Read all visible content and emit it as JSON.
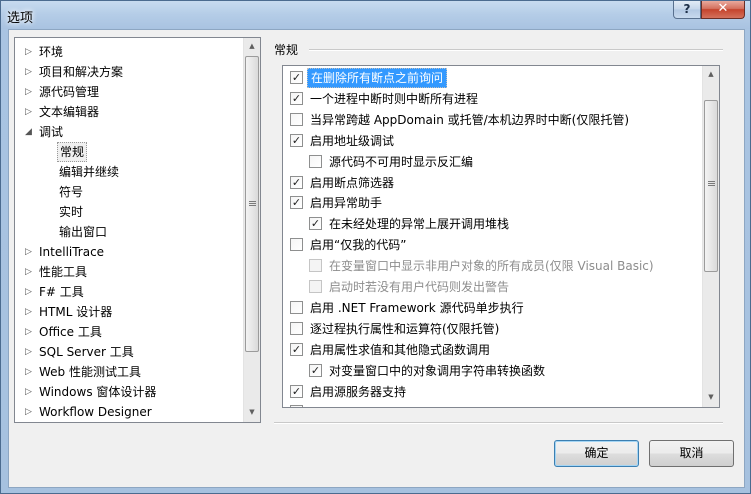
{
  "window": {
    "title": "选项",
    "help_label": "?",
    "close_label": "✕"
  },
  "tree": {
    "items": [
      {
        "label": "环境",
        "expanded": false
      },
      {
        "label": "项目和解决方案",
        "expanded": false
      },
      {
        "label": "源代码管理",
        "expanded": false
      },
      {
        "label": "文本编辑器",
        "expanded": false
      },
      {
        "label": "调试",
        "expanded": true
      },
      {
        "label": "常规",
        "child": true,
        "selected": true
      },
      {
        "label": "编辑并继续",
        "child": true
      },
      {
        "label": "符号",
        "child": true
      },
      {
        "label": "实时",
        "child": true
      },
      {
        "label": "输出窗口",
        "child": true
      },
      {
        "label": "IntelliTrace",
        "expanded": false
      },
      {
        "label": "性能工具",
        "expanded": false
      },
      {
        "label": "F# 工具",
        "expanded": false
      },
      {
        "label": "HTML 设计器",
        "expanded": false
      },
      {
        "label": "Office 工具",
        "expanded": false
      },
      {
        "label": "SQL Server 工具",
        "expanded": false
      },
      {
        "label": "Web 性能测试工具",
        "expanded": false
      },
      {
        "label": "Windows 窗体设计器",
        "expanded": false
      },
      {
        "label": "Workflow Designer",
        "expanded": false
      }
    ]
  },
  "section": {
    "title": "常规"
  },
  "options": [
    {
      "label": "在删除所有断点之前询问",
      "checked": true,
      "indent": 0,
      "highlight": true
    },
    {
      "label": "一个进程中断时则中断所有进程",
      "checked": true,
      "indent": 0
    },
    {
      "label": "当异常跨越 AppDomain 或托管/本机边界时中断(仅限托管)",
      "checked": false,
      "indent": 0
    },
    {
      "label": "启用地址级调试",
      "checked": true,
      "indent": 0
    },
    {
      "label": "源代码不可用时显示反汇编",
      "checked": false,
      "indent": 1
    },
    {
      "label": "启用断点筛选器",
      "checked": true,
      "indent": 0
    },
    {
      "label": "启用异常助手",
      "checked": true,
      "indent": 0
    },
    {
      "label": "在未经处理的异常上展开调用堆栈",
      "checked": true,
      "indent": 1
    },
    {
      "label": "启用“仅我的代码”",
      "checked": false,
      "indent": 0
    },
    {
      "label": "在变量窗口中显示非用户对象的所有成员(仅限 Visual Basic)",
      "checked": false,
      "indent": 1,
      "disabled": true
    },
    {
      "label": "启动时若没有用户代码则发出警告",
      "checked": false,
      "indent": 1,
      "disabled": true
    },
    {
      "label": "启用 .NET Framework 源代码单步执行",
      "checked": false,
      "indent": 0
    },
    {
      "label": "逐过程执行属性和运算符(仅限托管)",
      "checked": false,
      "indent": 0
    },
    {
      "label": "启用属性求值和其他隐式函数调用",
      "checked": true,
      "indent": 0
    },
    {
      "label": "对变量窗口中的对象调用字符串转换函数",
      "checked": true,
      "indent": 1
    },
    {
      "label": "启用源服务器支持",
      "checked": true,
      "indent": 0
    }
  ],
  "buttons": {
    "ok": "确定",
    "cancel": "取消"
  }
}
